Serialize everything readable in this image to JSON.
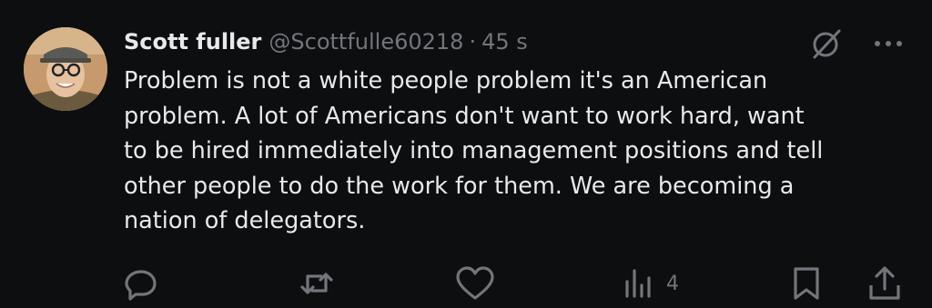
{
  "tweet": {
    "author_name": "Scott fuller",
    "handle": "@Scottfulle60218",
    "separator": "·",
    "time": "45 s",
    "text": "Problem is not a white people problem it's an American\nproblem. A lot of Americans don't want to work hard, want\nto be hired immediately into management positions and tell\nother people to do the work for them. We are becoming a\nnation of delegators."
  },
  "header_icons": {
    "mute": "muted-circle-slash-icon",
    "more": "more-options-icon"
  },
  "actions": {
    "reply_icon": "reply-icon",
    "repost_icon": "repost-icon",
    "like_icon": "heart-icon",
    "views_icon": "views-chart-icon",
    "views_count": "4",
    "bookmark_icon": "bookmark-icon",
    "share_icon": "share-icon"
  },
  "colors": {
    "background": "#0d0e10",
    "primary_text": "#e7e9ea",
    "secondary_text": "#71767b"
  }
}
